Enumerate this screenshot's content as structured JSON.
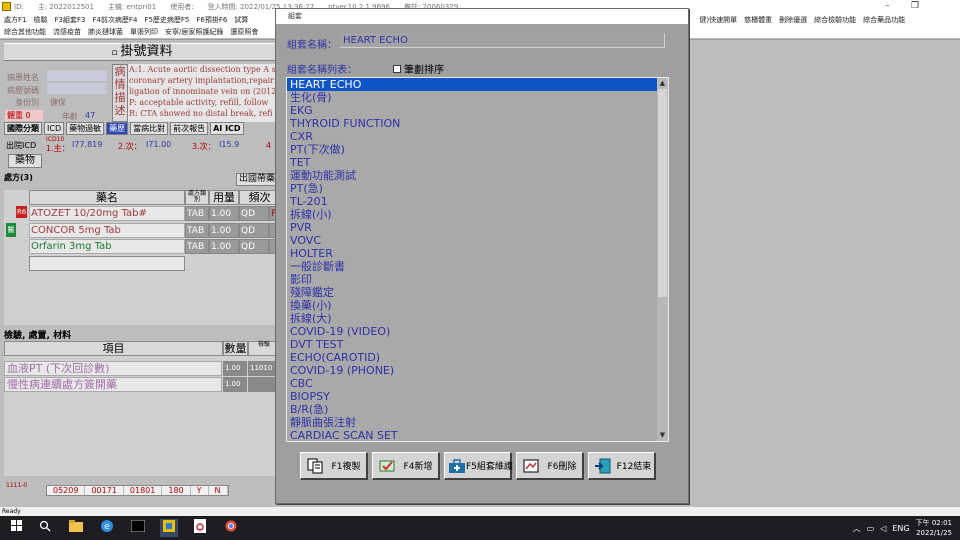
{
  "app": {
    "titlebar": [
      "ID:",
      "主: 2022012501",
      "主機: entpri01",
      "使用者:",
      "登入時間: 2022/01/25 13:36:27",
      "ntvec10.2.1.9696",
      "備註: 20060329"
    ],
    "window_controls": [
      "–",
      "❐"
    ]
  },
  "menu1": [
    "處方F1",
    "檢驗",
    "F3組套F3",
    "F4前次病歷F4",
    "F5歷史病歷F5",
    "F6預掛F6",
    "試算",
    "健)快速開單",
    "慈櫃體重",
    "刪除優選",
    "綜合檢驗功能",
    "綜合藥品功能"
  ],
  "menu2": [
    "綜合其他功能",
    "流感疫苗",
    "肺炎鏈球菌",
    "單張列印",
    "安寧/居家照護紀錄",
    "還原照會"
  ],
  "registration": {
    "title": "掛號資料",
    "labels": {
      "patient_name": "病患姓名",
      "chart_no": "病歷號碼",
      "identity": "身份別",
      "identity_value": "健保",
      "exam": "體重",
      "exam_value": "0",
      "age": "年齡",
      "age_value": "47"
    },
    "diag_box_label": "病情描述",
    "diag_lines": [
      "A:1. Acute aortic dissection type A s/p",
      "coronary artery implantation,repair",
      "ligation of innominate vein on (2012",
      "P: acceptable activity, refill, follow",
      "R: CTA showed no distal break, refi"
    ],
    "tabs": [
      "國際分類",
      "ICD",
      "藥物過敏",
      "藥歷",
      "當病比對",
      "前次報告",
      "AI ICD"
    ],
    "icd": {
      "out_label": "出院ICD",
      "icd10_label": "ICD10",
      "main_label": "1.主：",
      "main_value": "I77.819",
      "second_label": "2.次：",
      "second_value": "I71.00",
      "third_label": "3.次：",
      "third_value": "I15.9",
      "fourth_label": "4"
    },
    "med_tab": "藥物",
    "rx_header": "處方(3)",
    "abroad_button": "出國帶藥",
    "rx_columns": {
      "name": "藥名",
      "route": "處方類別",
      "dose": "用量",
      "freq": "頻次"
    },
    "rx_rows": [
      {
        "badge": "R6",
        "name": "ATOZET 10/20mg Tab#",
        "route": "TAB",
        "dose": "1.00",
        "freq": "QD",
        "extra": "P",
        "color": "#a03c3c"
      },
      {
        "badge": "",
        "name": "CONCOR 5mg Tab",
        "route": "TAB",
        "dose": "1.00",
        "freq": "QD",
        "extra": "",
        "color": "#a03c3c"
      },
      {
        "badge": "",
        "name": "Orfarin 3mg Tab",
        "route": "TAB",
        "dose": "1.00",
        "freq": "QD",
        "extra": "",
        "color": "#1b7a2e"
      }
    ],
    "side_badge": "醫",
    "exam_header": "檢驗, 處置, 材料",
    "exam_columns": {
      "item": "項目",
      "qty": "數量",
      "code": "檢驗"
    },
    "exam_rows": [
      {
        "name": "血液PT (下次回診數)",
        "qty": "1.00",
        "code": "11010"
      },
      {
        "name": "慢性病連續處方簽開藥",
        "qty": "1.00",
        "code": ""
      }
    ],
    "bottom_label": "1111-0",
    "bottom_codes": [
      "05209",
      "00171",
      "01801",
      "180",
      "Y",
      "N"
    ]
  },
  "status_bar": "Ready",
  "dialog": {
    "title": "組套",
    "name_label": "組套名稱：",
    "name_value": "HEART ECHO",
    "list_label": "組套名稱列表：",
    "stroke_sort_label": "筆劃排序",
    "items": [
      "HEART ECHO",
      "生化(骨)",
      "EKG",
      "THYROID  FUNCTION",
      "CXR",
      "PT(下次做)",
      "TET",
      "運動功能測試",
      "PT(急)",
      "TL-201",
      "拆線(小)",
      "PVR",
      "VOVC",
      "HOLTER",
      "一般診斷書",
      "影印",
      "殘障鑑定",
      "換藥(小)",
      "拆線(大)",
      "COVID-19 (VIDEO)",
      "DVT TEST",
      "ECHO(CAROTID)",
      "COVID-19 (PHONE)",
      "CBC",
      "BIOPSY",
      "B/R(急)",
      "靜脈曲張注射",
      "CARDIAC SCAN SET"
    ],
    "selected_index": 0,
    "buttons": [
      {
        "label": "F1複製",
        "icon": "copy-icon"
      },
      {
        "label": "F4新增",
        "icon": "add-icon"
      },
      {
        "label": "F5組套維護",
        "icon": "maintain-icon"
      },
      {
        "label": "F6刪除",
        "icon": "delete-icon"
      },
      {
        "label": "F12結束",
        "icon": "exit-icon"
      }
    ]
  },
  "taskbar": {
    "lang": "ENG",
    "time": "下午 02:01",
    "date": "2022/1/25"
  }
}
